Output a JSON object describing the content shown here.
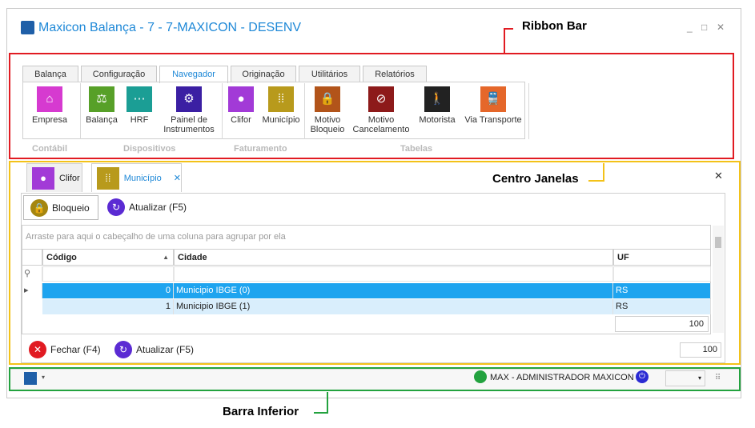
{
  "window": {
    "title": "Maxicon Balança - 7 - 7-MAXICON - DESENV",
    "controls": [
      "_",
      "□",
      "✕"
    ]
  },
  "callouts": {
    "ribbon": "Ribbon Bar",
    "centro": "Centro Janelas",
    "barra": "Barra Inferior"
  },
  "colors": {
    "ribbon_outline": "#e11b22",
    "centro_outline": "#f3c219",
    "barra_outline": "#23a23f",
    "accent": "#1e88d7"
  },
  "ribbon": {
    "tabs": [
      "Balança",
      "Configuração",
      "Navegador",
      "Originação",
      "Utilitários",
      "Relatórios"
    ],
    "active_tab": "Navegador",
    "buttons": [
      {
        "label": "Empresa",
        "icon": "home-icon",
        "color": "#d63ad0"
      },
      {
        "label": "Balança",
        "icon": "scale-icon",
        "color": "#57a028"
      },
      {
        "label": "HRF",
        "icon": "network-icon",
        "color": "#1b9e95"
      },
      {
        "label": "Painel de Instrumentos",
        "icon": "gears-icon",
        "color": "#3b1fa3"
      },
      {
        "label": "Clifor",
        "icon": "person-icon",
        "color": "#a23ad7"
      },
      {
        "label": "Município",
        "icon": "grid-icon",
        "color": "#b89a1c"
      },
      {
        "label": "Motivo Bloqueio",
        "icon": "lock-person-icon",
        "color": "#b2541a"
      },
      {
        "label": "Motivo Cancelamento",
        "icon": "cancel-person-icon",
        "color": "#8d1a1a"
      },
      {
        "label": "Motorista",
        "icon": "walking-icon",
        "color": "#222222"
      },
      {
        "label": "Via Transporte",
        "icon": "train-icon",
        "color": "#e5672a"
      }
    ],
    "groups": [
      "Contábil",
      "Dispositivos",
      "Faturamento",
      "Tabelas"
    ]
  },
  "doc_tabs": [
    {
      "label": "Clifor",
      "icon": "person-icon"
    },
    {
      "label": "Município",
      "icon": "grid-icon",
      "close": "✕"
    }
  ],
  "close_all": "✕",
  "toolbar": {
    "bloqueio": "Bloqueio",
    "atualizar": "Atualizar (F5)"
  },
  "grid": {
    "group_hint": "Arraste para aqui o cabeçalho de uma coluna para agrupar por ela",
    "columns": [
      "Código",
      "Cidade",
      "UF"
    ],
    "rows": [
      {
        "codigo": "0",
        "cidade": "Municipio IBGE (0)",
        "uf": "RS"
      },
      {
        "codigo": "1",
        "cidade": "Municipio IBGE (1)",
        "uf": "RS"
      }
    ],
    "page_size": "100"
  },
  "footer": {
    "fechar": "Fechar (F4)",
    "atualizar": "Atualizar (F5)",
    "page_size": "100"
  },
  "status": {
    "user": "MAX - ADMINISTRADOR MAXICON"
  }
}
